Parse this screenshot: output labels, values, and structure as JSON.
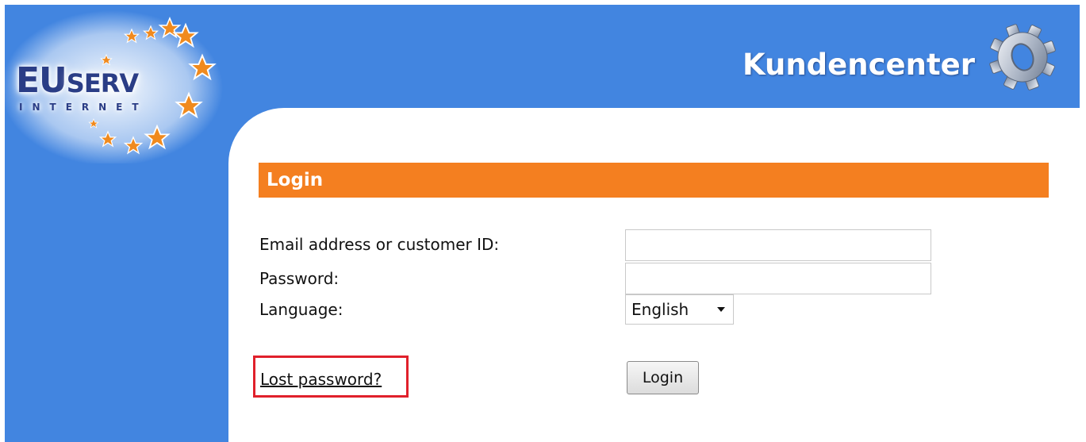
{
  "brand": {
    "logo_main": "EU",
    "logo_rest": "SERV",
    "logo_sub": "INTERNET",
    "title": "Kundencenter"
  },
  "login": {
    "heading": "Login",
    "email_label": "Email address or customer ID:",
    "email_value": "",
    "password_label": "Password:",
    "password_value": "",
    "language_label": "Language:",
    "language_selected": "English",
    "lost_password_link": "Lost password?",
    "login_button": "Login"
  },
  "colors": {
    "background_blue": "#4285e0",
    "header_orange": "#f47f20",
    "highlight_red": "#e0202b",
    "logo_navy": "#2a3d86",
    "star_orange": "#f08a1e"
  },
  "icons": [
    "star-icon",
    "gear-icon",
    "dropdown-caret-icon"
  ]
}
